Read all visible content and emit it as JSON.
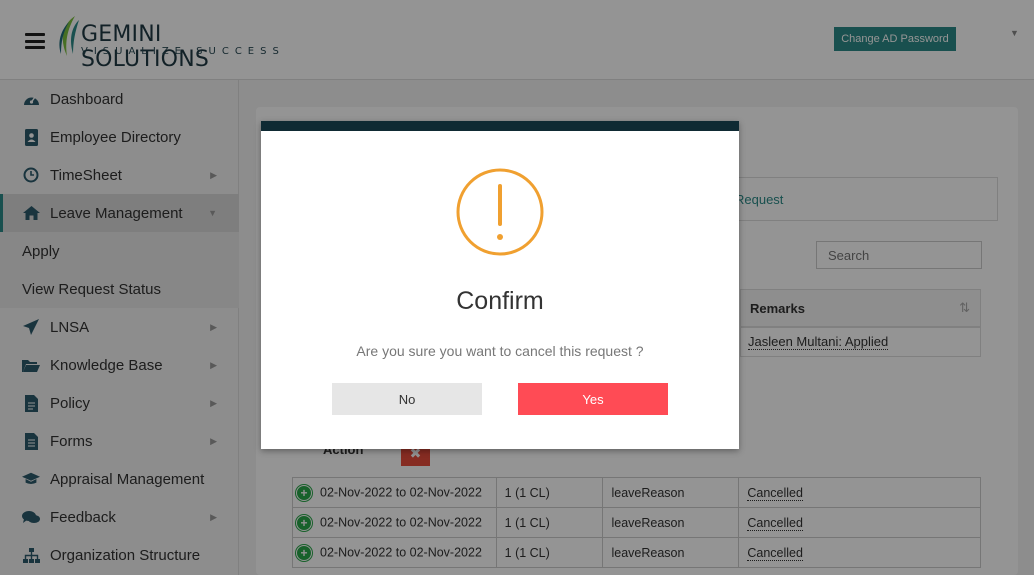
{
  "header": {
    "logo_name": "GEMINI SOLUTIONS",
    "logo_tagline": "VISUALIZE SUCCESS",
    "change_password_label": "Change AD Password"
  },
  "sidebar": {
    "items": [
      {
        "label": "Dashboard",
        "icon": "dashboard-icon"
      },
      {
        "label": "Employee Directory",
        "icon": "address-book-icon"
      },
      {
        "label": "TimeSheet",
        "icon": "clock-icon"
      },
      {
        "label": "Leave Management",
        "icon": "home-icon"
      },
      {
        "label": "Apply"
      },
      {
        "label": "View Request Status"
      },
      {
        "label": "LNSA",
        "icon": "paper-plane-icon"
      },
      {
        "label": "Knowledge Base",
        "icon": "folder-open-icon"
      },
      {
        "label": "Policy",
        "icon": "file-icon"
      },
      {
        "label": "Forms",
        "icon": "file-text-icon"
      },
      {
        "label": "Appraisal Management",
        "icon": "graduation-cap-icon"
      },
      {
        "label": "Feedback",
        "icon": "comments-icon"
      },
      {
        "label": "Organization Structure",
        "icon": "sitemap-icon"
      }
    ]
  },
  "main": {
    "tab_partial": "Request",
    "search_placeholder": "Search",
    "remarks_header": "Remarks",
    "remarks_value": "Jasleen Multani: Applied",
    "action_label": "Action",
    "rows": [
      {
        "date": "02-Nov-2022 to 02-Nov-2022",
        "days": "1 (1 CL)",
        "reason": "leaveReason",
        "status": "Cancelled"
      },
      {
        "date": "02-Nov-2022 to 02-Nov-2022",
        "days": "1 (1 CL)",
        "reason": "leaveReason",
        "status": "Cancelled"
      },
      {
        "date": "02-Nov-2022 to 02-Nov-2022",
        "days": "1 (1 CL)",
        "reason": "leaveReason",
        "status": "Cancelled"
      }
    ]
  },
  "modal": {
    "title": "Confirm",
    "message": "Are you sure you want to cancel this request ?",
    "no_label": "No",
    "yes_label": "Yes"
  },
  "colors": {
    "accent": "#2c8b88",
    "danger": "#ff4b55",
    "warning": "#f0a030",
    "modal_bar": "#0f2a33"
  }
}
